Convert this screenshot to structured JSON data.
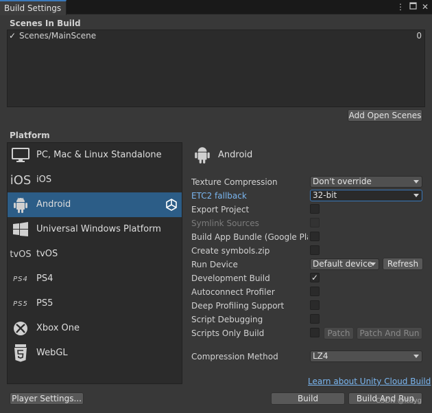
{
  "window": {
    "tab_title": "Build Settings"
  },
  "scenes": {
    "title": "Scenes In Build",
    "items": [
      {
        "name": "Scenes/MainScene",
        "checked": true,
        "index": "0"
      }
    ],
    "add_open_scenes_label": "Add Open Scenes"
  },
  "platform": {
    "title": "Platform",
    "items": [
      {
        "label": "PC, Mac & Linux Standalone",
        "icon": "monitor-icon"
      },
      {
        "label": "iOS",
        "icon": "ios-icon",
        "icon_text": "iOS"
      },
      {
        "label": "Android",
        "icon": "android-icon",
        "selected": true
      },
      {
        "label": "Universal Windows Platform",
        "icon": "windows-icon"
      },
      {
        "label": "tvOS",
        "icon": "tvos-icon",
        "icon_text": "tvOS"
      },
      {
        "label": "PS4",
        "icon": "ps4-icon",
        "icon_text": "PS4"
      },
      {
        "label": "PS5",
        "icon": "ps5-icon",
        "icon_text": "PS5"
      },
      {
        "label": "Xbox One",
        "icon": "xbox-icon"
      },
      {
        "label": "WebGL",
        "icon": "html5-icon"
      }
    ]
  },
  "settings": {
    "platform_name": "Android",
    "texture_compression": {
      "label": "Texture Compression",
      "value": "Don't override"
    },
    "etc2_fallback": {
      "label": "ETC2 fallback",
      "value": "32-bit"
    },
    "export_project": {
      "label": "Export Project",
      "checked": false
    },
    "symlink_sources": {
      "label": "Symlink Sources",
      "checked": false,
      "disabled": true
    },
    "build_app_bundle": {
      "label": "Build App Bundle (Google Play)",
      "checked": false
    },
    "create_symbols": {
      "label": "Create symbols.zip",
      "checked": false
    },
    "run_device": {
      "label": "Run Device",
      "value": "Default device",
      "refresh_label": "Refresh"
    },
    "development_build": {
      "label": "Development Build",
      "checked": true
    },
    "autoconnect_profiler": {
      "label": "Autoconnect Profiler",
      "checked": false
    },
    "deep_profiling": {
      "label": "Deep Profiling Support",
      "checked": false
    },
    "script_debugging": {
      "label": "Script Debugging",
      "checked": false
    },
    "scripts_only_build": {
      "label": "Scripts Only Build",
      "checked": false,
      "patch_label": "Patch",
      "patch_and_run_label": "Patch And Run"
    },
    "compression_method": {
      "label": "Compression Method",
      "value": "LZ4"
    },
    "cloud_build_link": "Learn about Unity Cloud Build"
  },
  "footer": {
    "player_settings_label": "Player Settings...",
    "build_label": "Build",
    "build_and_run_label": "Build And Run"
  },
  "watermark": "CSDN @ltdyg",
  "colors": {
    "background": "#383838",
    "selection": "#2c5d87",
    "link": "#7ab6f0",
    "focus": "#3a79bb"
  }
}
